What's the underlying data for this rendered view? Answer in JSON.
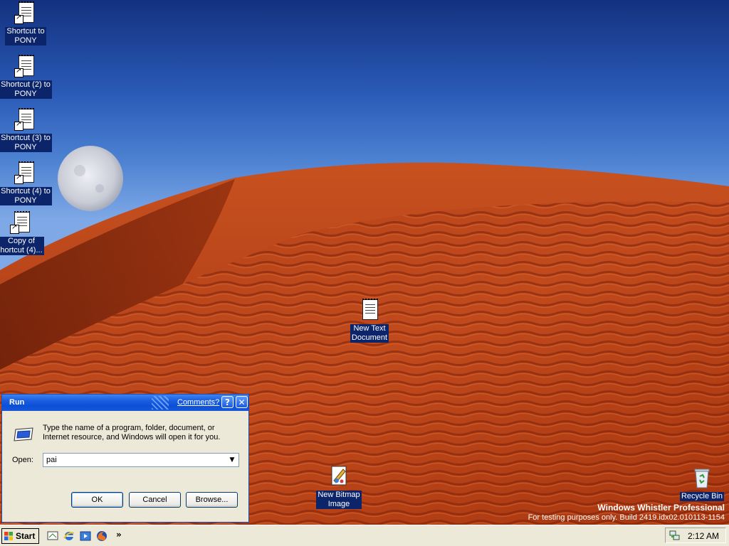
{
  "desktop": {
    "icons": [
      {
        "label_line1": "Shortcut to",
        "label_line2": "PONY"
      },
      {
        "label_line1": "Shortcut (2) to",
        "label_line2": "PONY"
      },
      {
        "label_line1": "Shortcut (3) to",
        "label_line2": "PONY"
      },
      {
        "label_line1": "Shortcut (4) to",
        "label_line2": "PONY"
      },
      {
        "label_line1": "Copy of",
        "label_line2": "hortcut (4)..."
      },
      {
        "label_line1": "New Text",
        "label_line2": "Document"
      },
      {
        "label_line1": "New Bitmap",
        "label_line2": "Image"
      },
      {
        "label_line1": "Recycle Bin",
        "label_line2": ""
      }
    ],
    "watermark": {
      "line1": "Windows Whistler Professional",
      "line2": "For testing purposes only. Build 2419.idx02.010113-1154"
    }
  },
  "run_dialog": {
    "title": "Run",
    "comments_link": "Comments?",
    "help_glyph": "?",
    "close_glyph": "✕",
    "prompt_line1": "Type the name of a program, folder, document, or",
    "prompt_line2": "Internet resource, and Windows will open it for you.",
    "open_label": "Open:",
    "open_value": "pai",
    "ok_label": "OK",
    "cancel_label": "Cancel",
    "browse_label": "Browse..."
  },
  "taskbar": {
    "start_label": "Start",
    "quicklaunch_overflow": "»",
    "clock": "2:12 AM"
  },
  "colors": {
    "sky_top": "#14317f",
    "dune": "#b8401a",
    "selection_label_bg": "#0b246a",
    "titlebar": "#0b4fd6",
    "dialog_bg": "#ece9d8"
  }
}
